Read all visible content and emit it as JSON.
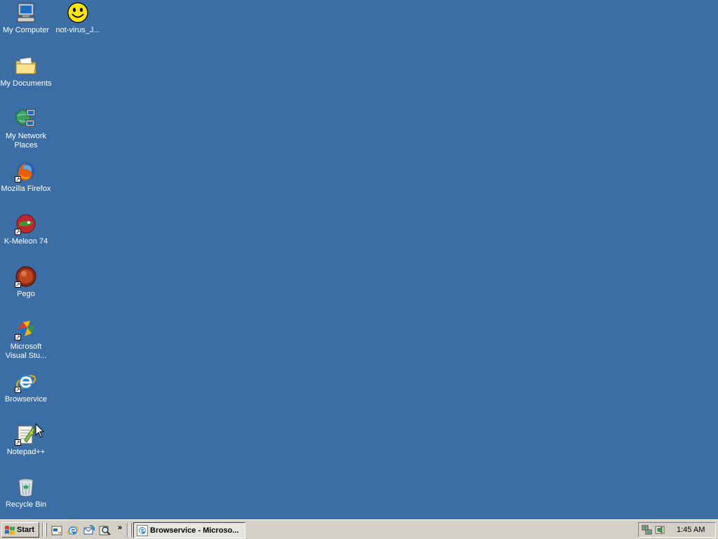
{
  "desktop": {
    "background_color": "#3a6ea5",
    "icons": [
      {
        "label": "My Computer",
        "icon": "my-computer-icon"
      },
      {
        "label": "not-virus_J...",
        "icon": "smiley-icon"
      },
      {
        "label": "My Documents",
        "icon": "folder-icon"
      },
      {
        "label": "My Network Places",
        "icon": "network-icon"
      },
      {
        "label": "Mozilla Firefox",
        "icon": "firefox-icon"
      },
      {
        "label": "K-Meleon 74",
        "icon": "k-meleon-icon"
      },
      {
        "label": "Pego",
        "icon": "pego-icon"
      },
      {
        "label": "Microsoft Visual Stu...",
        "icon": "visual-studio-icon"
      },
      {
        "label": "Browservice",
        "icon": "internet-explorer-icon"
      },
      {
        "label": "Notepad++",
        "icon": "notepad-plus-plus-icon"
      },
      {
        "label": "Recycle Bin",
        "icon": "recycle-bin-icon"
      }
    ]
  },
  "taskbar": {
    "start_label": "Start",
    "quick_launch": [
      "show-desktop-icon",
      "internet-explorer-icon",
      "outlook-express-icon",
      "search-icon"
    ],
    "quick_launch_more": "»",
    "tasks": [
      {
        "label": "Browservice - Microso...",
        "icon": "internet-explorer-icon"
      }
    ],
    "tray": {
      "icons": [
        "network-tray-icon",
        "volume-tray-icon"
      ],
      "clock": "1:45 AM"
    }
  }
}
